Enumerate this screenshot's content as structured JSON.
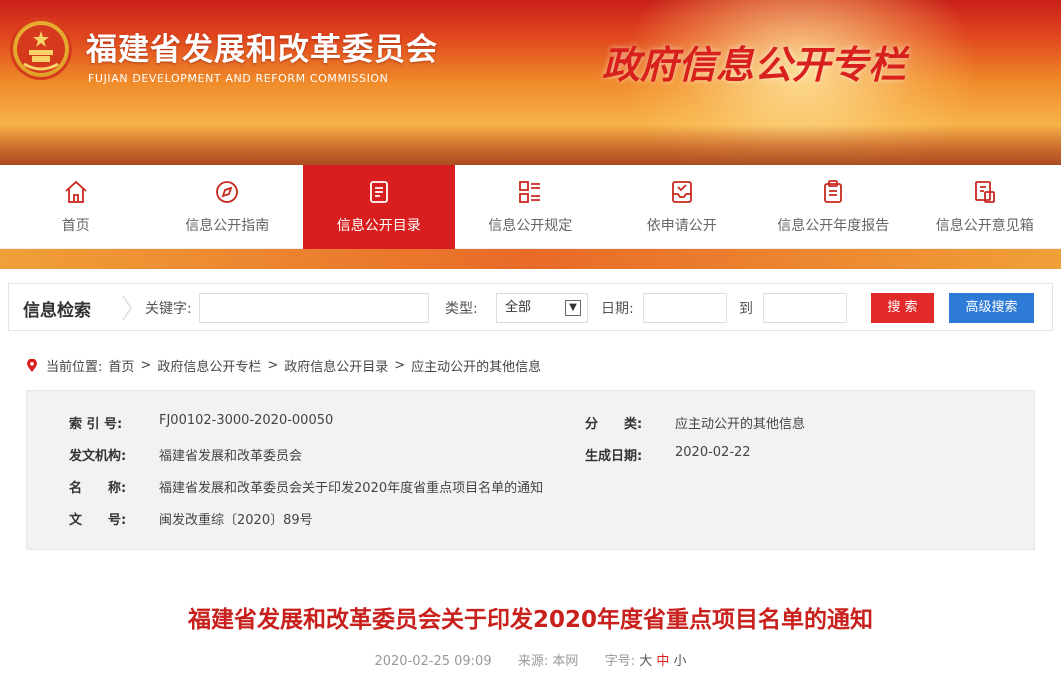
{
  "header": {
    "org_name": "福建省发展和改革委员会",
    "org_name_en": "FUJIAN DEVELOPMENT AND REFORM COMMISSION",
    "banner_title": "政府信息公开专栏"
  },
  "nav": {
    "items": [
      {
        "label": "首页",
        "icon": "home-icon"
      },
      {
        "label": "信息公开指南",
        "icon": "compass-icon"
      },
      {
        "label": "信息公开目录",
        "icon": "document-list-icon",
        "active": true
      },
      {
        "label": "信息公开规定",
        "icon": "grid-list-icon"
      },
      {
        "label": "依申请公开",
        "icon": "inbox-check-icon"
      },
      {
        "label": "信息公开年度报告",
        "icon": "clipboard-icon"
      },
      {
        "label": "信息公开意见箱",
        "icon": "feedback-icon"
      }
    ]
  },
  "search": {
    "title": "信息检索",
    "keyword_label": "关键字:",
    "keyword_value": "",
    "type_label": "类型:",
    "type_selected": "全部",
    "date_label": "日期:",
    "date_from": "",
    "to_label": "到",
    "date_to": "",
    "search_button": "搜 索",
    "advanced_button": "高级搜索"
  },
  "breadcrumb": {
    "prefix": "当前位置:",
    "items": [
      "首页",
      ">",
      "政府信息公开专栏",
      ">",
      "政府信息公开目录",
      ">",
      "应主动公开的其他信息"
    ]
  },
  "info": {
    "index_key": "索 引 号:",
    "index_value": "FJ00102-3000-2020-00050",
    "category_key": "分　　类:",
    "category_value": "应主动公开的其他信息",
    "issuer_key": "发文机构:",
    "issuer_value": "福建省发展和改革委员会",
    "date_key": "生成日期:",
    "date_value": "2020-02-22",
    "name_key": "名　　称:",
    "name_value": "福建省发展和改革委员会关于印发2020年度省重点项目名单的通知",
    "docno_key": "文　　号:",
    "docno_value": "闽发改重综〔2020〕89号"
  },
  "article": {
    "title": "福建省发展和改革委员会关于印发2020年度省重点项目名单的通知",
    "datetime": "2020-02-25 09:09",
    "source_label": "来源:",
    "source_value": "本网",
    "fontsize_label": "字号:",
    "fontsize_large": "大",
    "fontsize_medium": "中",
    "fontsize_small": "小"
  },
  "colors": {
    "brand_red": "#d81e1e",
    "title_red": "#c8201c",
    "search_red": "#e22a2a",
    "advanced_blue": "#2d7bd6",
    "stripe_orange": "#e86a28"
  }
}
